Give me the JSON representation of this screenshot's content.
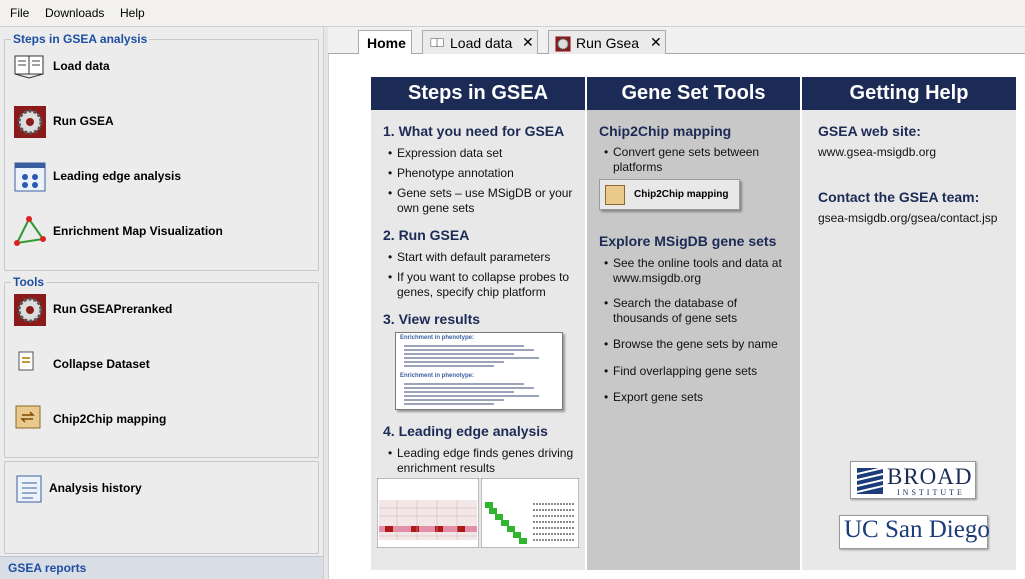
{
  "menu": [
    "File",
    "Downloads",
    "Help"
  ],
  "left_panel": {
    "steps_title": "Steps in GSEA analysis",
    "steps": [
      {
        "label": "Load data",
        "icon": "book-icon"
      },
      {
        "label": "Run GSEA",
        "icon": "gear-icon"
      },
      {
        "label": "Leading edge analysis",
        "icon": "cluster-window-icon"
      },
      {
        "label": "Enrichment Map Visualization",
        "icon": "network-triangle-icon"
      }
    ],
    "tools_title": "Tools",
    "tools": [
      {
        "label": "Run GSEAPreranked",
        "icon": "gear-icon"
      },
      {
        "label": "Collapse Dataset",
        "icon": "dataset-icon"
      },
      {
        "label": "Chip2Chip mapping",
        "icon": "chip-mapping-icon"
      }
    ],
    "history_label": "Analysis history",
    "reports_label": "GSEA reports"
  },
  "tabs": [
    {
      "label": "Home",
      "active": true,
      "closable": false
    },
    {
      "label": "Load data",
      "active": false,
      "closable": true,
      "close": "✕"
    },
    {
      "label": "Run Gsea",
      "active": false,
      "closable": true,
      "close": "✕"
    }
  ],
  "home": {
    "col1": {
      "title": "Steps in GSEA",
      "s1_title": "1. What you need for GSEA",
      "s1_b1": "Expression data set",
      "s1_b2": "Phenotype annotation",
      "s1_b3": "Gene sets – use MSigDB or your own gene sets",
      "s2_title": "2. Run GSEA",
      "s2_b1": "Start with default parameters",
      "s2_b2": "If you want to collapse probes to genes, specify chip platform",
      "s3_title": "3. View results",
      "s3_thumb_head1": "Enrichment in phenotype:",
      "s3_thumb_head2": "Enrichment in phenotype:",
      "s4_title": "4. Leading edge analysis",
      "s4_b1": "Leading edge finds genes driving enrichment results"
    },
    "col2": {
      "title": "Gene Set Tools",
      "s1_title": "Chip2Chip mapping",
      "s1_b1": "Convert gene sets between platforms",
      "button_label": "Chip2Chip mapping",
      "s2_title": "Explore MSigDB gene sets",
      "s2_b1": "See the online tools and data at www.msigdb.org",
      "s2_b2": "Search the database of thousands of gene sets",
      "s2_b3": "Browse the gene sets by name",
      "s2_b4": "Find overlapping gene sets",
      "s2_b5": "Export gene sets"
    },
    "col3": {
      "title": "Getting Help",
      "web_title": "GSEA web site:",
      "web_url": "www.gsea-msigdb.org",
      "contact_title": "Contact the GSEA team:",
      "contact_url": "gsea-msigdb.org/gsea/contact.jsp",
      "logo1": "BROAD",
      "logo1_sub": "INSTITUTE",
      "logo2": "UC San Diego"
    }
  },
  "colors": {
    "header_navy": "#1b2b56",
    "link_blue": "#1e4fa1",
    "col_light": "#e8e8e8",
    "col_mid": "#c8c8c8"
  }
}
